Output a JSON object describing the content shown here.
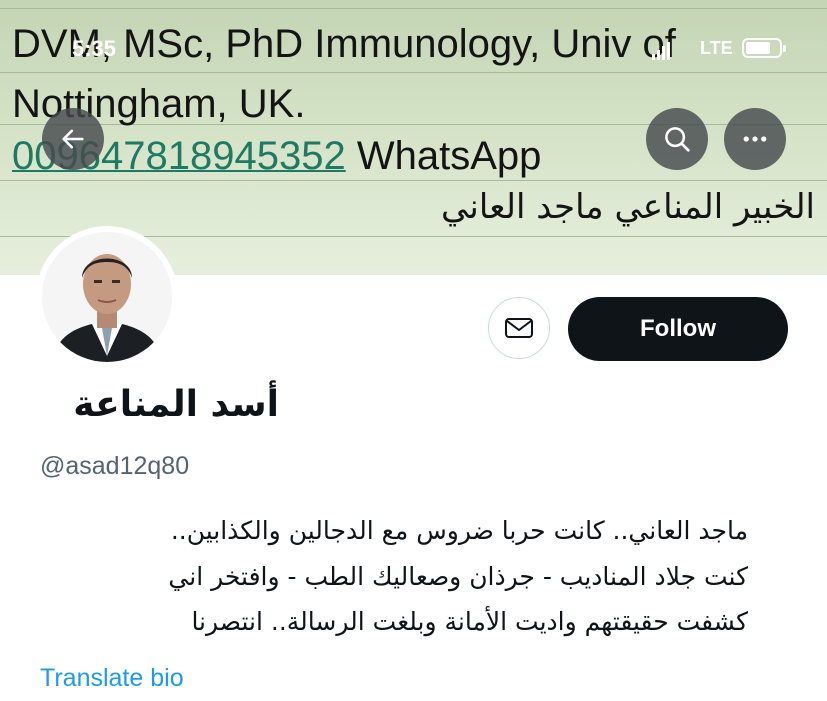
{
  "status_bar": {
    "time": "5:35",
    "network": "LTE"
  },
  "banner": {
    "line1": "DVM, MSc, PhD Immunology, Univ of",
    "line2": "Nottingham, UK.",
    "phone": "009647818945352",
    "phone_suffix": "WhatsApp",
    "line4": "الخبير المناعي ماجد العاني"
  },
  "profile": {
    "display_name": "أسد المناعة",
    "handle": "@asad12q80",
    "bio_lines": [
      "ماجد العاني.. كانت حربا ضروس مع الدجالين والكذابين..",
      "كنت جلاد المناديب - جرذان وصعاليك الطب - وافتخر اني",
      "كشفت حقيقتهم واديت الأمانة وبلغت الرسالة.. انتصرنا"
    ],
    "follow_label": "Follow",
    "translate_label": "Translate bio"
  },
  "icons": {
    "back": "arrow-left-icon",
    "search": "search-icon",
    "more": "more-horizontal-icon",
    "message": "envelope-icon"
  },
  "colors": {
    "follow_bg": "#0f1419",
    "link_blue": "#1d9bf0",
    "phone_green": "#1e7a63",
    "handle_gray": "#536471"
  }
}
